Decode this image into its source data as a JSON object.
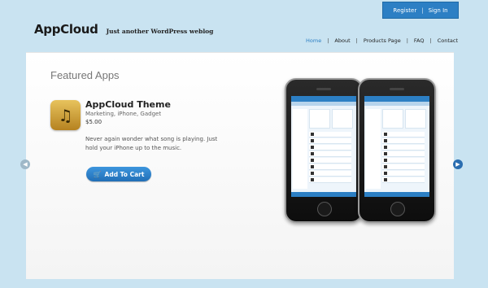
{
  "auth": {
    "register": "Register",
    "separator": "|",
    "sign_in": "Sign In"
  },
  "brand": {
    "logo": "AppCloud",
    "tagline": "Just another WordPress weblog"
  },
  "nav": {
    "items": [
      "Home",
      "About",
      "Products Page",
      "FAQ",
      "Contact"
    ],
    "active": "Home"
  },
  "featured": {
    "title": "Featured Apps",
    "app": {
      "name": "AppCloud Theme",
      "categories": "Marketing, iPhone, Gadget",
      "price": "$5.00",
      "description": "Never again wonder what song is playing. Just hold your iPhone up to the music.",
      "icon": "music-note-icon"
    },
    "cart_button": "Add To Cart"
  },
  "colors": {
    "accent": "#2c7fc4",
    "background": "#c9e3f1"
  }
}
